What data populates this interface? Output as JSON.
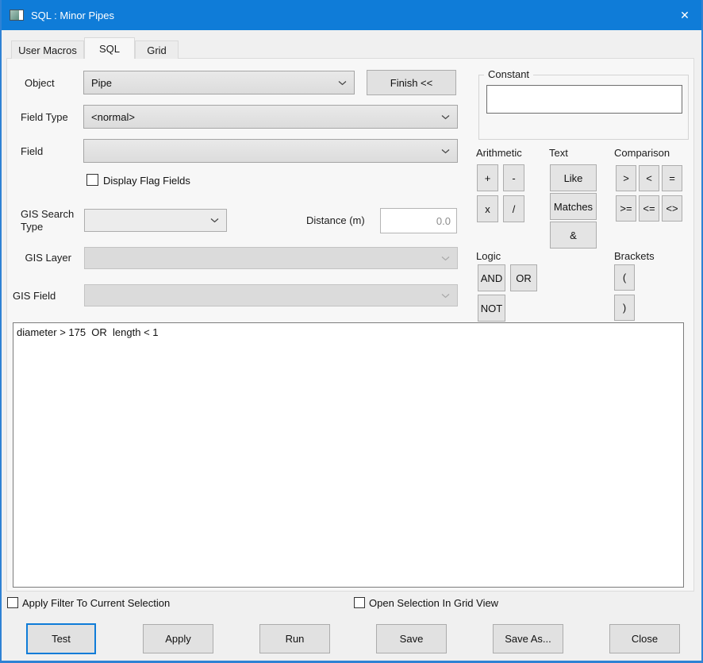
{
  "window": {
    "title": "SQL : Minor Pipes",
    "close_glyph": "✕"
  },
  "tabs": [
    {
      "label": "User Macros"
    },
    {
      "label": "SQL"
    },
    {
      "label": "Grid"
    }
  ],
  "form": {
    "object_label": "Object",
    "object_value": "Pipe",
    "finish_button_label": "Finish <<",
    "field_type_label": "Field Type",
    "field_type_value": "<normal>",
    "field_value": "",
    "field_label": "Field",
    "display_flag_label": "Display Flag Fields",
    "gis_search_type_label": "GIS Search Type",
    "gis_search_type_value": "",
    "distance_label": "Distance (m)",
    "distance_value": "0.0",
    "gis_layer_label": "GIS Layer",
    "gis_layer_value": "",
    "gis_field_label": "GIS Field",
    "gis_field_value": ""
  },
  "operators": {
    "constant_label": "Constant",
    "constant_value": "",
    "arithmetic_label": "Arithmetic",
    "arithmetic_buttons": [
      "+",
      "-",
      "x",
      "/"
    ],
    "text_label": "Text",
    "text_buttons": [
      "Like",
      "Matches",
      "&"
    ],
    "comparison_label": "Comparison",
    "comparison_buttons": [
      ">",
      "<",
      "=",
      ">=",
      "<=",
      "<>"
    ],
    "logic_label": "Logic",
    "logic_buttons": [
      "AND",
      "OR",
      "NOT"
    ],
    "brackets_label": "Brackets",
    "brackets_buttons": [
      "(",
      ")"
    ]
  },
  "sql_editor": {
    "query": "diameter > 175  OR  length < 1"
  },
  "footer": {
    "apply_filter_label": "Apply Filter To Current Selection",
    "open_selection_label": "Open Selection In Grid View",
    "test_label": "Test",
    "apply_label": "Apply",
    "run_label": "Run",
    "save_label": "Save",
    "save_as_label": "Save As...",
    "close_label": "Close"
  },
  "colors": {
    "titlebar": "#0f7cd8",
    "window_border": "#2e82d4",
    "dialog_bg": "#f0f0f0"
  }
}
